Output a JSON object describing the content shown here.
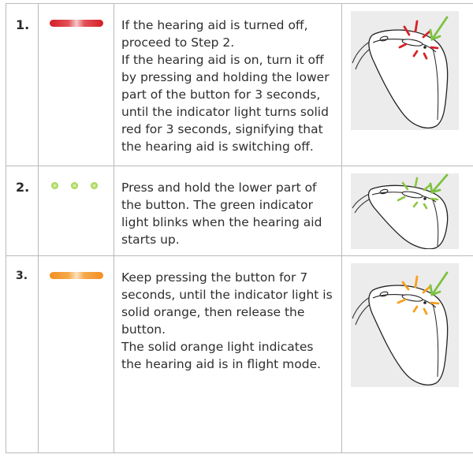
{
  "steps": [
    {
      "number": "1.",
      "indicator": "solid-red",
      "text": [
        "If the hearing aid is turned off, proceed to Step 2.",
        "If the hearing aid is on, turn it off by pressing and holding the lower part of the button for 3 seconds, until the indicator light turns solid red for 3 seconds, signifying that the hearing aid is switching off."
      ],
      "light_color": "#d7222a",
      "illustration": "hearing-aid-button-red-light"
    },
    {
      "number": "2.",
      "indicator": "blinking-green",
      "text": [
        "Press and hold the lower part of the button. The green indicator light blinks when the hearing aid starts up."
      ],
      "light_color": "#8dc63f",
      "illustration": "hearing-aid-button-green-light"
    },
    {
      "number": "3.",
      "indicator": "solid-orange",
      "text": [
        "Keep pressing the button  for 7 seconds, until the indicator light is solid orange, then release the button.",
        "The solid orange light indicates the hearing aid is in flight mode."
      ],
      "light_color": "#f7a01e",
      "illustration": "hearing-aid-button-orange-light"
    }
  ],
  "colors": {
    "arrow": "#7cc242",
    "border": "#b9b9b9",
    "illustration_bg": "#ececec"
  }
}
